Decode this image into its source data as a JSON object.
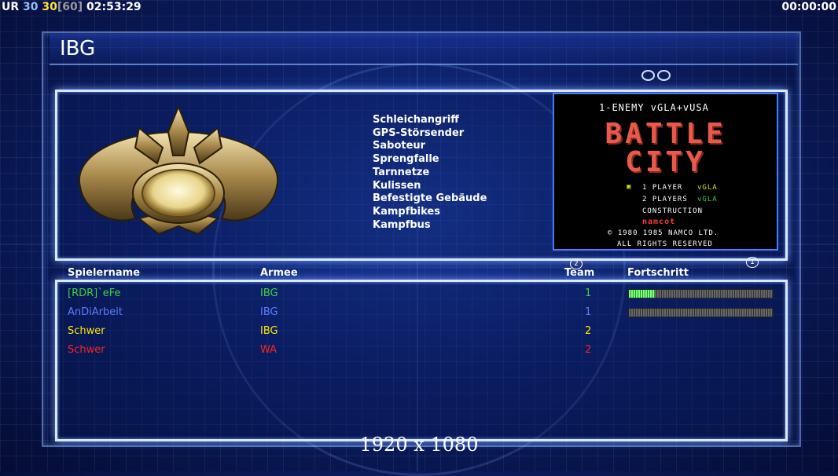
{
  "hud": {
    "prefix": "UR",
    "fps_a": "30",
    "fps_b": "30",
    "fps_limit": "[60]",
    "time_left": "02:53:29",
    "time_right": "00:00:00"
  },
  "header": {
    "title": "IBG"
  },
  "powers": [
    "Schleichangriff",
    "GPS-Störsender",
    "Saboteur",
    "Sprengfalle",
    "Tarnnetze",
    "Kulissen",
    "Befestigte Gebäude",
    "Kampfbikes",
    "Kampfbus"
  ],
  "map": {
    "header": "1-ENEMY vGLA+vUSA",
    "title_line1": "BATTLE",
    "title_line2": "CITY",
    "opt1": "1 PLAYER",
    "opt1_tag": "vGLA",
    "opt2": "2 PLAYERS",
    "opt2_tag": "vGLA",
    "opt3": "CONSTRUCTION",
    "brand": "namcot",
    "copyright": "© 1980 1985 NAMCO LTD.",
    "rights": "ALL RIGHTS RESERVED"
  },
  "markers": {
    "m2": "2",
    "m1": "1"
  },
  "columns": {
    "name": "Spielername",
    "army": "Armee",
    "team": "Team",
    "progress": "Fortschritt"
  },
  "players": [
    {
      "name": "[RDR]`eFe",
      "army": "IBG",
      "team": "1",
      "color": "#3fd23f",
      "progress": 0.18
    },
    {
      "name": "AnDiArbeit",
      "army": "IBG",
      "team": "1",
      "color": "#5b7cff",
      "progress": 0.0
    },
    {
      "name": "Schwer",
      "army": "IBG",
      "team": "2",
      "color": "#ffe600",
      "progress": null
    },
    {
      "name": "Schwer",
      "army": "WA",
      "team": "2",
      "color": "#ff2020",
      "progress": null
    }
  ],
  "resolution": "1920 x 1080"
}
